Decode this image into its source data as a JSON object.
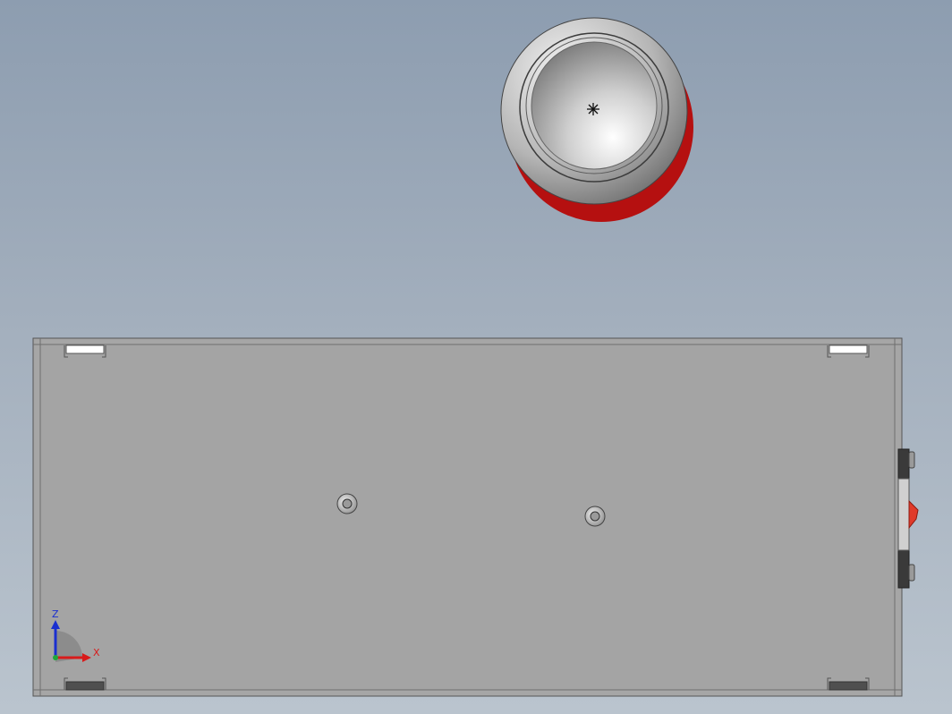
{
  "app": {
    "view": "top",
    "background_gradient": [
      "#8d9db0",
      "#bac4ce"
    ]
  },
  "model": {
    "parts": [
      {
        "name": "can",
        "color_body": "#c81414",
        "color_lid": "#d8d8d8"
      },
      {
        "name": "enclosure-plate",
        "color": "#a5a5a5"
      },
      {
        "name": "rocker-switch",
        "color": "#e03a2a"
      }
    ]
  },
  "triad": {
    "z_label": "Z",
    "x_label": "X",
    "colors": {
      "z": "#1a2fd0",
      "x": "#d81b1b",
      "y": "#1fa83a"
    }
  }
}
